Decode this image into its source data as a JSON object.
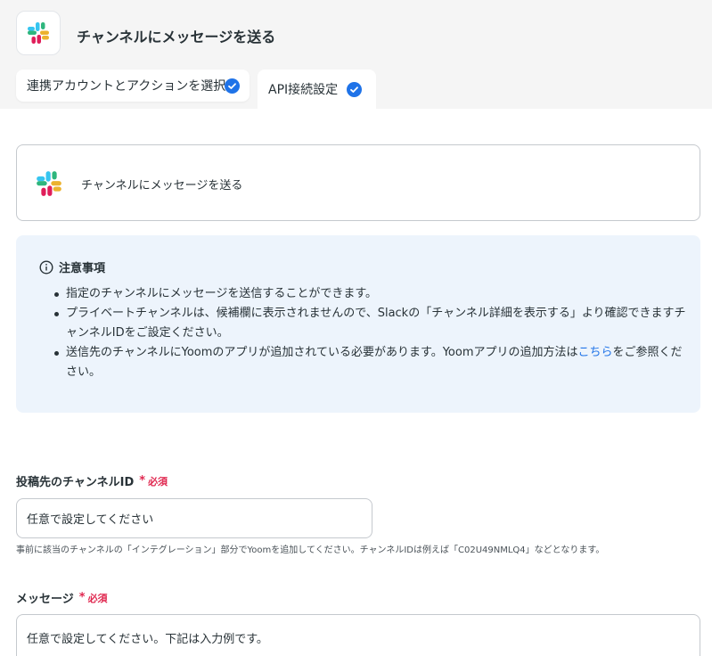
{
  "header": {
    "app_icon": "slack-logo",
    "title": "チャンネルにメッセージを送る"
  },
  "tabs": [
    {
      "label": "連携アカウントとアクションを選択",
      "status_icon": "check-circle-icon"
    },
    {
      "label": "API接続設定",
      "status_icon": "check-circle-icon"
    }
  ],
  "action": {
    "icon": "slack-logo",
    "label": "チャンネルにメッセージを送る"
  },
  "notice": {
    "icon": "info-circle-icon",
    "title": "注意事項",
    "items": [
      "指定のチャンネルにメッセージを送信することができます。",
      "プライベートチャンネルは、候補欄に表示されませんので、Slackの「チャンネル詳細を表示する」より確認できますチャンネルIDをご設定ください。",
      "送信先のチャンネルにYoomのアプリが追加されている必要があります。Yoomアプリの追加方法は"
    ],
    "item3_link": "こちら",
    "item3_suffix": "をご参照ください。"
  },
  "fields": {
    "channel_id": {
      "label": "投稿先のチャンネルID",
      "required_mark": "*",
      "required_text": "必須",
      "value": "任意で設定してください",
      "help": "事前に該当のチャンネルの「インテグレーション」部分でYoomを追加してください。チャンネルIDは例えば「C02U49NMLQ4」などとなります。"
    },
    "message": {
      "label": "メッセージ",
      "required_mark": "*",
      "required_text": "必須",
      "value": "任意で設定してください。下記は入力例です。"
    }
  },
  "colors": {
    "accent": "#1f73e8",
    "required": "#e02850",
    "notice_bg": "#edf4fc",
    "header_bg": "#f5f5f5"
  }
}
